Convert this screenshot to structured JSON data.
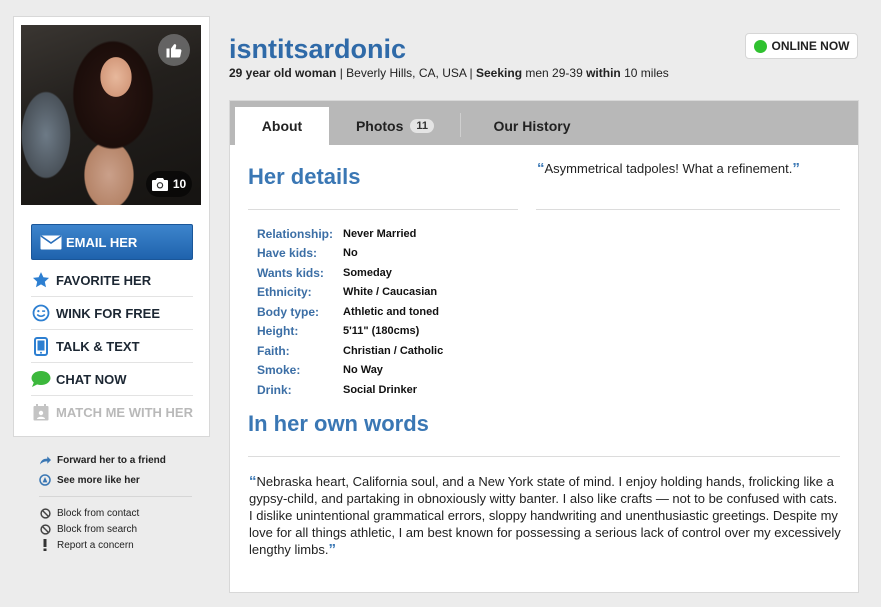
{
  "profile": {
    "username": "isntitsardonic",
    "age_gender": "29 year old woman",
    "location": "Beverly Hills, CA, USA",
    "seeking_label": "Seeking",
    "seeking_value": "men 29-39",
    "within_label": "within",
    "within_value": "10 miles",
    "status": "ONLINE NOW",
    "status_color": "#2fc12f",
    "photo_count": "10"
  },
  "actions": {
    "email": "EMAIL HER",
    "items": [
      {
        "label": "FAVORITE HER",
        "icon": "star-icon"
      },
      {
        "label": "WINK FOR FREE",
        "icon": "wink-smiley-icon"
      },
      {
        "label": "TALK & TEXT",
        "icon": "phone-icon"
      },
      {
        "label": "CHAT NOW",
        "icon": "chat-bubble-icon"
      },
      {
        "label": "MATCH ME WITH HER",
        "icon": "calendar-icon",
        "disabled": true
      }
    ]
  },
  "links": {
    "forward": "Forward her to a friend",
    "see_more": "See more like her",
    "block_contact": "Block from contact",
    "block_search": "Block from search",
    "report": "Report a concern"
  },
  "tabs": [
    {
      "label": "About",
      "active": true
    },
    {
      "label": "Photos",
      "badge": "11"
    },
    {
      "label": "Our History"
    }
  ],
  "about": {
    "details_heading": "Her details",
    "tagline": "Asymmetrical tadpoles! What a refinement.",
    "details": [
      {
        "label": "Relationship:",
        "value": "Never Married"
      },
      {
        "label": "Have kids:",
        "value": "No"
      },
      {
        "label": "Wants kids:",
        "value": "Someday"
      },
      {
        "label": "Ethnicity:",
        "value": "White / Caucasian"
      },
      {
        "label": "Body type:",
        "value": "Athletic and toned"
      },
      {
        "label": "Height:",
        "value": "5'11\" (180cms)"
      },
      {
        "label": "Faith:",
        "value": "Christian / Catholic"
      },
      {
        "label": "Smoke:",
        "value": "No Way"
      },
      {
        "label": "Drink:",
        "value": "Social Drinker"
      }
    ],
    "words_heading": "In her own words",
    "bio": "Nebraska heart, California soul, and a New York state of mind. I enjoy holding hands, frolicking like a gypsy-child, and partaking in obnoxiously witty banter. I also like crafts — not to be confused with cats. I dislike unintentional grammatical errors, sloppy handwriting and unenthusiastic greetings. Despite my love for all things athletic, I am best known for possessing a serious lack of control over my excessively lengthy limbs."
  },
  "colors": {
    "accent_blue": "#3a77b4",
    "email_button": "#2a6fba",
    "tab_bar": "#b8b8b8"
  }
}
